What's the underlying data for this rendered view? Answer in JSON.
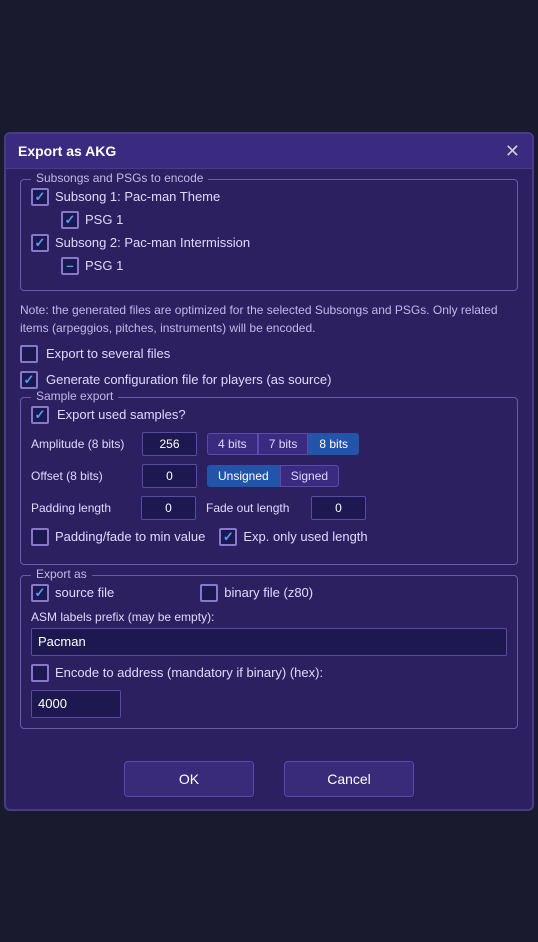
{
  "dialog": {
    "title": "Export as AKG",
    "close_label": "✕"
  },
  "subsongs_group": {
    "label": "Subsongs and PSGs to encode",
    "items": [
      {
        "id": "subsong1",
        "label": "Subsong 1: Pac-man Theme",
        "checked": true,
        "indent": false
      },
      {
        "id": "psg1",
        "label": "PSG 1",
        "checked": true,
        "indent": true
      },
      {
        "id": "subsong2",
        "label": "Subsong 2: Pac-man Intermission",
        "checked": true,
        "indent": false
      },
      {
        "id": "psg2",
        "label": "PSG 1",
        "checked": "partial",
        "indent": true
      }
    ]
  },
  "note": "Note: the generated files are optimized for the selected Subsongs and PSGs. Only related items (arpeggios, pitches, instruments) will be encoded.",
  "export_several": {
    "label": "Export to several files",
    "checked": false
  },
  "generate_config": {
    "label": "Generate configuration file for players (as source)",
    "checked": true
  },
  "sample_export": {
    "group_label": "Sample export",
    "export_samples_label": "Export used samples?",
    "export_samples_checked": true,
    "amplitude_label": "Amplitude (8 bits)",
    "amplitude_value": "256",
    "amplitude_buttons": [
      "4 bits",
      "7 bits",
      "8 bits"
    ],
    "amplitude_active": "8 bits",
    "offset_label": "Offset (8 bits)",
    "offset_value": "0",
    "offset_buttons": [
      "Unsigned",
      "Signed"
    ],
    "offset_active": "Unsigned",
    "padding_label": "Padding length",
    "padding_value": "0",
    "fade_label": "Fade out length",
    "fade_value": "0",
    "padding_fade_label": "Padding/fade to min value",
    "padding_fade_checked": false,
    "exp_length_label": "Exp. only used length",
    "exp_length_checked": true
  },
  "export_as": {
    "group_label": "Export as",
    "source_label": "source file",
    "source_checked": true,
    "binary_label": "binary file (z80)",
    "binary_checked": false,
    "asm_label": "ASM labels prefix (may be empty):",
    "asm_value": "Pacman",
    "encode_label": "Encode to address (mandatory if binary) (hex):",
    "encode_checked": false,
    "encode_value": "4000"
  },
  "footer": {
    "ok_label": "OK",
    "cancel_label": "Cancel"
  }
}
